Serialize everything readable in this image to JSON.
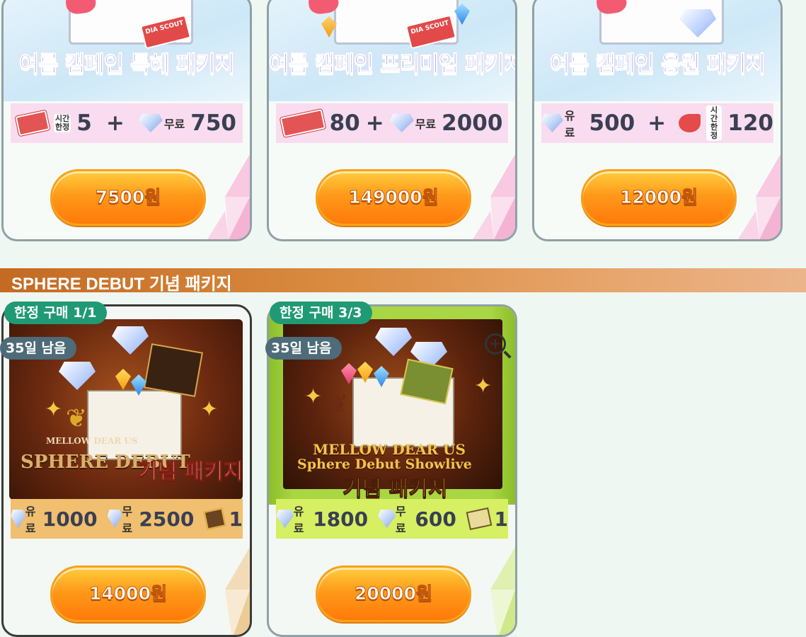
{
  "top_packages": [
    {
      "title": "여름 캠페인 특혜 패키지",
      "items": [
        {
          "icon": "scout-ticket-icon",
          "tag": "시간\n한정",
          "amount": "5"
        },
        {
          "sep": "+"
        },
        {
          "icon": "diamond-icon",
          "tag": "무료",
          "amount": "750"
        }
      ],
      "ticket_text": "DIA SCOUT",
      "price": "7500원"
    },
    {
      "title": "여름 캠페인 프리미엄 패키지",
      "items": [
        {
          "icon": "scout-ticket-icon",
          "amount": "80"
        },
        {
          "sep": "+"
        },
        {
          "icon": "diamond-icon",
          "tag": "무료",
          "amount": "2000"
        }
      ],
      "ticket_text": "DIA SCOUT",
      "price": "149000원"
    },
    {
      "title": "여름 캠페인 응원 패키지",
      "items": [
        {
          "icon": "diamond-icon",
          "tag": "유료",
          "amount": "500"
        },
        {
          "sep": "+"
        },
        {
          "icon": "whistle-icon",
          "tag": "시간\n한정",
          "amount": "120"
        }
      ],
      "price": "12000원"
    }
  ],
  "section": {
    "title": "SPHERE DEBUT 기념 패키지"
  },
  "sphere_packages": [
    {
      "limit": "한정 구매 1/1",
      "remaining": "35일 남음",
      "logo_line1": "MELLOW DEAR US",
      "logo_line2": "SPHERE DEBUT",
      "title_kr": "기념 패키지",
      "items": [
        {
          "tag": "유료",
          "amount": "1000"
        },
        {
          "tag": "무료",
          "amount": "2500"
        },
        {
          "amount": "1"
        }
      ],
      "price": "14000원",
      "row_color": "#f0bf6f"
    },
    {
      "limit": "한정 구매 3/3",
      "remaining": "35일 남음",
      "logo_line1": "MELLOW DEAR US",
      "logo_line2": "Sphere Debut Showlive",
      "title_kr": "기념 패키지",
      "items": [
        {
          "tag": "유료",
          "amount": "1800"
        },
        {
          "tag": "무료",
          "amount": "600"
        },
        {
          "amount": "1"
        }
      ],
      "price": "20000원",
      "row_color": "#d6ef63"
    }
  ],
  "colors": {
    "accent_orange": "#ff9a1a",
    "limit_badge_green": "#1f9a74",
    "remaining_badge_slate": "#4d6b78",
    "section_bar": "#c46a22"
  }
}
